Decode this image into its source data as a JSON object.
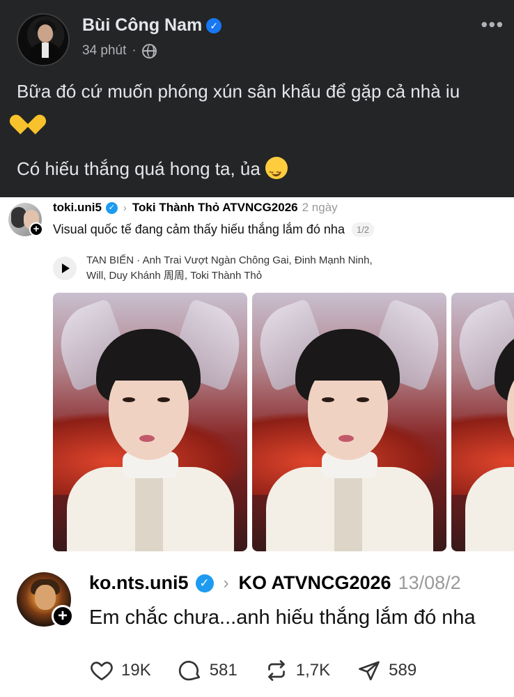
{
  "facebook_post": {
    "author_name": "Bùi Công Nam",
    "verified_badge": "✓",
    "timestamp": "34 phút",
    "separator": "·",
    "audience_icon": "globe-icon",
    "more_button": "•••",
    "text_line1": "Bữa đó cứ muốn phóng xún sân khấu để gặp cả nhà iu",
    "text_emoji1": "yellow-heart-emoji",
    "text_line2": "Có hiếu thắng quá hong ta, ủa",
    "text_emoji2": "smirking-face-emoji"
  },
  "threads_post_1": {
    "username": "toki.uni5",
    "verified_badge": "✓",
    "chevron": "›",
    "reply_to": "Toki Thành Thỏ ATVNCG2026",
    "time": "2 ngày",
    "caption": "Visual quốc tế đang cảm thấy hiếu thắng lắm đó nha",
    "pager": "1/2",
    "follow_badge": "+",
    "music_line1": "TAN BIẾN · Anh Trai Vượt Ngàn Chông Gai, Đinh Mạnh Ninh,",
    "music_line2": "Will, Duy Khánh 周周, Toki Thành Thỏ",
    "photo_count_visible": 3
  },
  "threads_post_2": {
    "username": "ko.nts.uni5",
    "verified_badge": "✓",
    "chevron": "›",
    "reply_to": "KO ATVNCG2026",
    "time": "13/08/2",
    "caption": "Em chắc chưa...anh hiếu thắng lắm đó nha",
    "follow_badge": "+",
    "likes": "19K",
    "comments": "581",
    "reposts": "1,7K",
    "shares": "589"
  },
  "colors": {
    "fb_background": "#242526",
    "fb_text": "#e4e6eb",
    "fb_muted": "#b0b3b8",
    "fb_verified": "#1877f2",
    "threads_verified": "#1d9bf0",
    "threads_muted": "#999999"
  }
}
